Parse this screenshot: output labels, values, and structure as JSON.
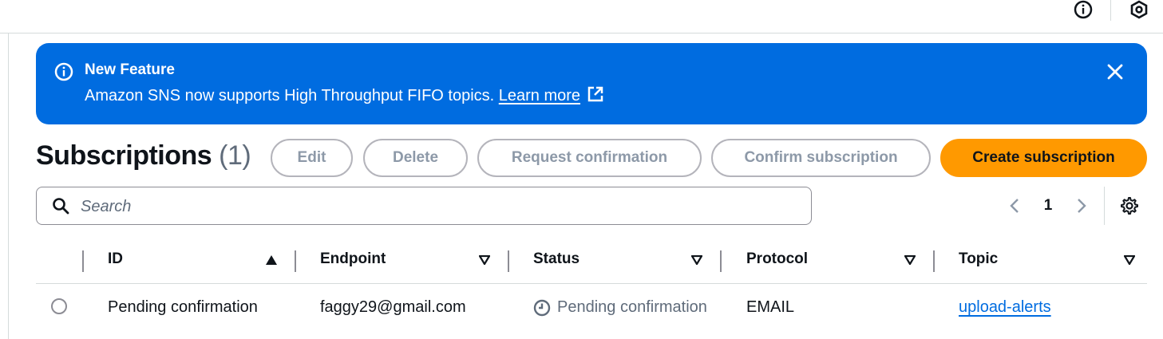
{
  "topbar": {
    "icons": [
      "info-icon",
      "settings-hex-icon"
    ]
  },
  "flash": {
    "title": "New Feature",
    "message": "Amazon SNS now supports High Throughput FIFO topics.",
    "link_label": "Learn more",
    "icon": "info-icon",
    "close_icon": "close-icon",
    "color": "#006ce0"
  },
  "header": {
    "title": "Subscriptions",
    "count": "(1)"
  },
  "actions": {
    "edit": "Edit",
    "delete": "Delete",
    "request_confirmation": "Request confirmation",
    "confirm_subscription": "Confirm subscription",
    "create_subscription": "Create subscription",
    "primary_color": "#ff9900"
  },
  "search": {
    "placeholder": "Search",
    "value": ""
  },
  "pagination": {
    "current_page": "1"
  },
  "table": {
    "columns": [
      {
        "label": "ID",
        "sort": "ascending"
      },
      {
        "label": "Endpoint",
        "sort": "none"
      },
      {
        "label": "Status",
        "sort": "none"
      },
      {
        "label": "Protocol",
        "sort": "none"
      },
      {
        "label": "Topic",
        "sort": "none"
      }
    ],
    "rows": [
      {
        "id": "Pending confirmation",
        "endpoint": "faggy29@gmail.com",
        "status": "Pending confirmation",
        "status_icon": "clock-icon",
        "protocol": "EMAIL",
        "topic": "upload-alerts",
        "selected": false
      }
    ]
  }
}
